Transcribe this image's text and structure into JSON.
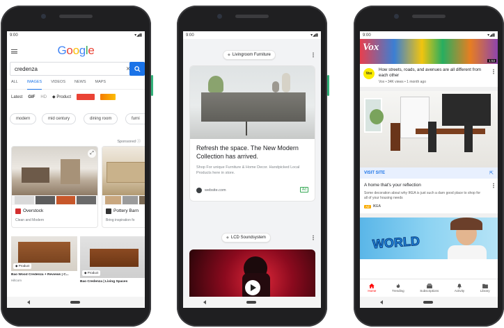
{
  "phone1": {
    "status_time": "9:00",
    "google_logo": "Google",
    "search_query": "credenza",
    "clear_icon": "×",
    "tabs": [
      "ALL",
      "IMAGES",
      "VIDEOS",
      "NEWS",
      "MAPS"
    ],
    "filters": {
      "latest": "Latest",
      "gif": "GIF",
      "hd": "HD",
      "product": "Product"
    },
    "chips": [
      "modern",
      "mid century",
      "dining room",
      "furni"
    ],
    "sponsored": "Sponsored",
    "ad_cards": [
      {
        "brand": "Overstock",
        "subtitle": "Clean and Modern"
      },
      {
        "brand": "Pottery Barn",
        "subtitle": "Bring inspiration fo"
      }
    ],
    "results": [
      {
        "badge": "Product",
        "title": "Bao Wood Credenza + Reviews | C...",
        "source": "Hiltcom"
      },
      {
        "badge": "Product",
        "title": "Bao Credenza | Living Spaces",
        "source": ""
      }
    ]
  },
  "phone2": {
    "status_time": "9:00",
    "card1_label": "Livingroom Furniture",
    "card1_headline": "Refresh the space. The New Modern Collection has arrived.",
    "card1_body": "Shop For unique Furniture & Home Decor. Handpicked Local Products here in store.",
    "card1_source": "website.com",
    "ad_badge": "Ad",
    "card2_label": "LCD Soundsystem"
  },
  "phone3": {
    "status_time": "9:00",
    "video_time": "1:53",
    "channel_badge": "Vox",
    "video_title": "How streets, roads, and avenues are all different from each other",
    "video_meta": "Vox • 34K views • 1 month ago",
    "visit_site": "VISIT SITE",
    "ad_title": "A home that's your reflection",
    "ad_body": "Some decoration about why IKEA is just such a darn good place to shop for all of your housing needs",
    "ad_badge": "Ad",
    "advertiser": "IKEA",
    "thumb_text": "WORLD",
    "bottom_tabs": [
      "Home",
      "Trending",
      "Subscriptions",
      "Activity",
      "Library"
    ]
  },
  "colors": {
    "google_blue": "#4285f4",
    "google_red": "#ea4335",
    "google_yellow": "#fbbc05",
    "google_green": "#34a853",
    "accent_blue": "#1a73e8",
    "youtube_red": "#ff0000",
    "ad_yellow": "#f9ab00"
  }
}
